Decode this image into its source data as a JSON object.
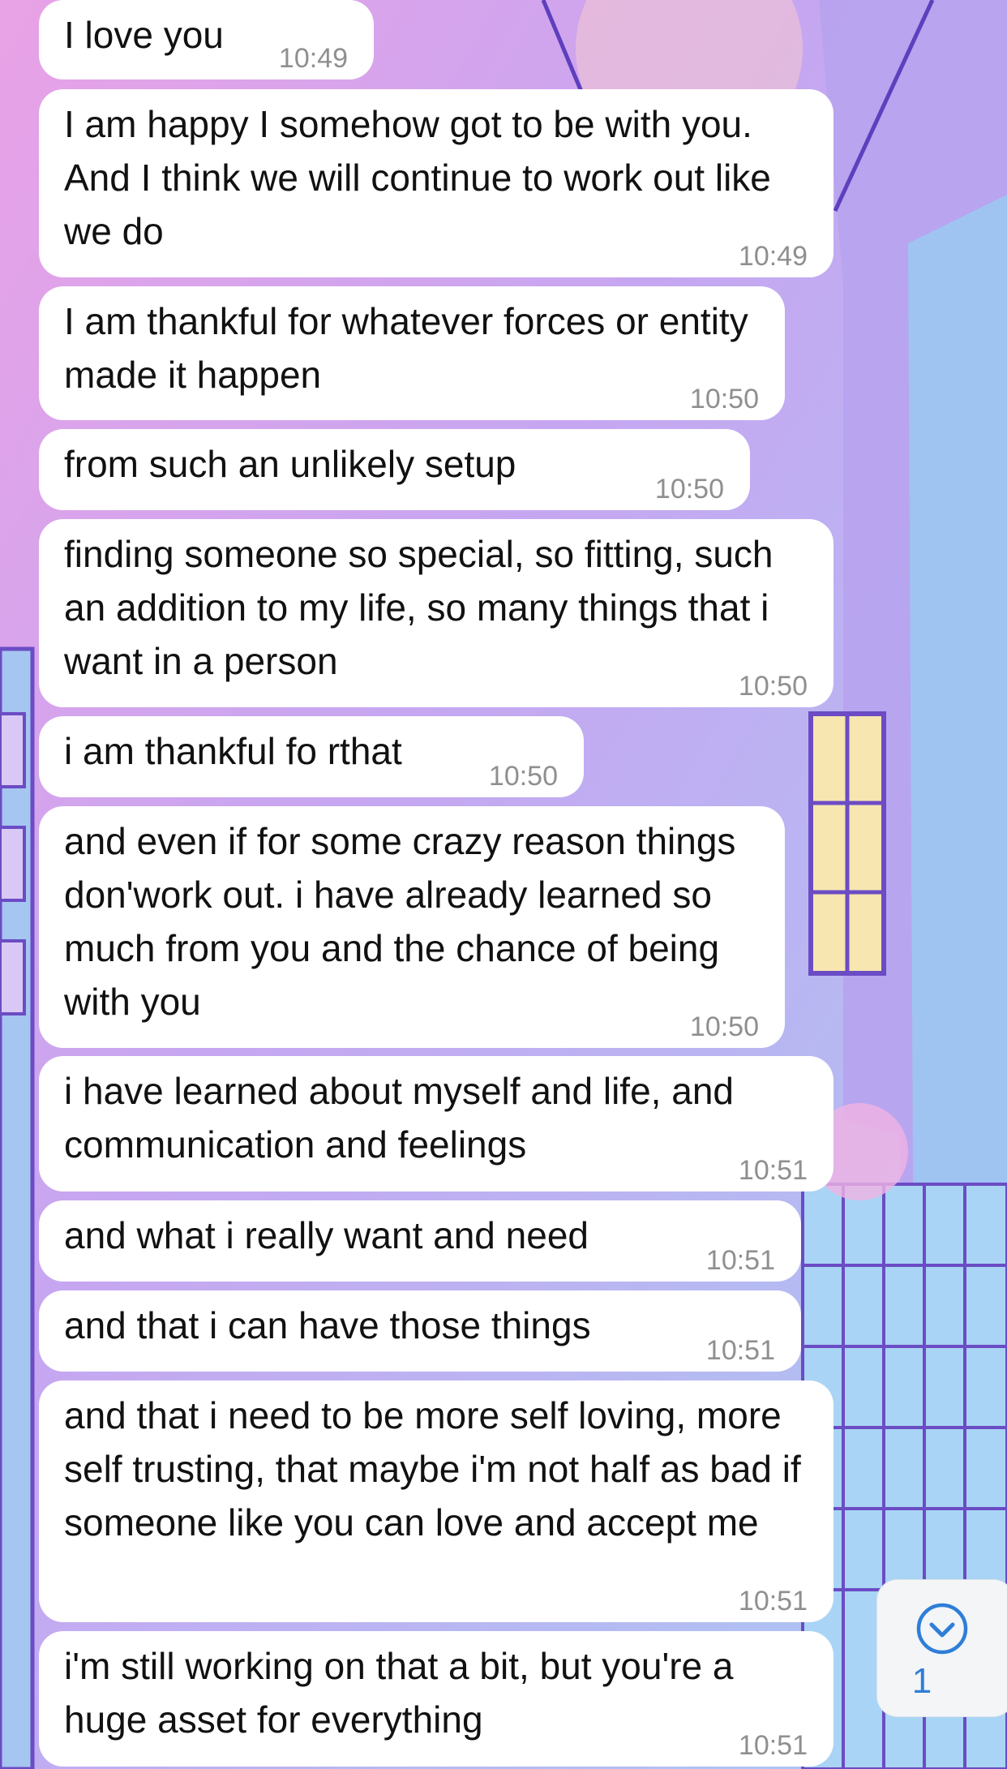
{
  "messages": [
    {
      "text": "I love you",
      "time": "10:49"
    },
    {
      "text": "I am happy I somehow got to be with you. And I think we will continue to work out like we do",
      "time": "10:49"
    },
    {
      "text": "I am thankful for whatever forces or entity made it happen",
      "time": "10:50"
    },
    {
      "text": "from such an unlikely setup",
      "time": "10:50"
    },
    {
      "text": "finding someone so special, so fitting, such an addition to my life, so many things that i want in a person",
      "time": "10:50"
    },
    {
      "text": "i am thankful fo rthat",
      "time": "10:50"
    },
    {
      "text": "and even if for some crazy reason things don'work out. i have already learned so much from you and the chance of being with you",
      "time": "10:50"
    },
    {
      "text": "i have learned about myself and life, and communication and feelings",
      "time": "10:51"
    },
    {
      "text": "and what i really want and need",
      "time": "10:51"
    },
    {
      "text": "and that i can have those things",
      "time": "10:51"
    },
    {
      "text": "and that i need to be more self loving, more self trusting, that maybe i'm not half as bad if someone like you can love and accept me",
      "time": "10:51"
    },
    {
      "text": "i'm still working on that a bit, but you're a huge asset for everything",
      "time": "10:51"
    }
  ],
  "scroll_down": {
    "icon": "chevron-down-circle-icon",
    "unread_count": "1"
  },
  "colors": {
    "bubble": "#ffffff",
    "accent": "#2f7ed8",
    "timestamp": "#8f8f8f"
  }
}
